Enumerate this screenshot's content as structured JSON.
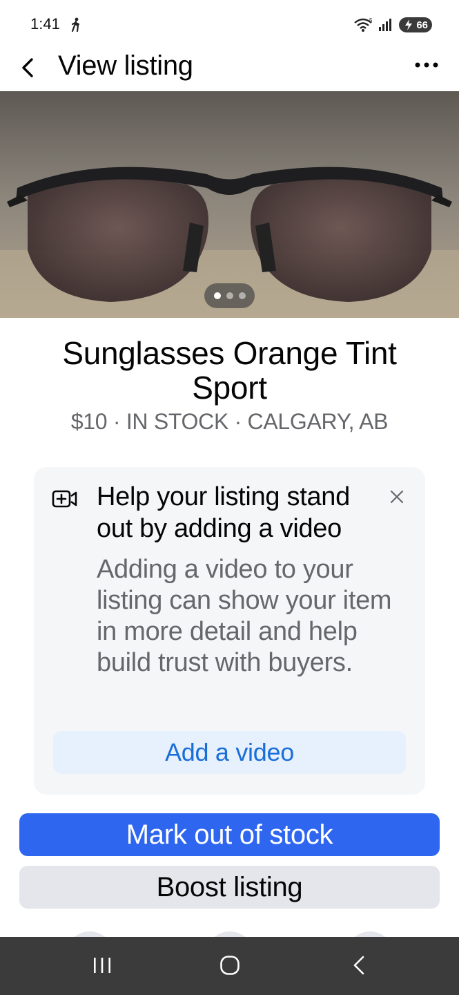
{
  "status_bar": {
    "time": "1:41",
    "battery_level": "66",
    "icons": [
      "walking-icon",
      "wifi-icon",
      "signal-icon",
      "battery-icon"
    ]
  },
  "header": {
    "title": "View listing",
    "back_icon": "chevron-left-icon",
    "more_icon": "more-horizontal-icon"
  },
  "photo": {
    "subject": "sunglasses",
    "pager": {
      "count": 3,
      "active_index": 0
    }
  },
  "listing": {
    "title": "Sunglasses Orange Tint Sport",
    "meta": "$10 · IN STOCK · CALGARY, AB"
  },
  "promo": {
    "icon": "video-add-icon",
    "heading": "Help your listing stand out by adding a video",
    "body": "Adding a video to your listing can show your item in more detail and help build trust with buyers.",
    "button_label": "Add a video",
    "close_icon": "close-icon"
  },
  "actions": {
    "primary_label": "Mark out of stock",
    "secondary_label": "Boost listing"
  },
  "nav_bar": {
    "icons": [
      "recents-icon",
      "home-icon",
      "back-icon"
    ]
  },
  "colors": {
    "primary_blue": "#2e66f0",
    "link_blue": "#1a6ed8",
    "secondary_gray": "#e4e6eb",
    "card_bg": "#f5f6f8",
    "muted_text": "#65676b",
    "nav_bar": "#3b3b3b"
  }
}
